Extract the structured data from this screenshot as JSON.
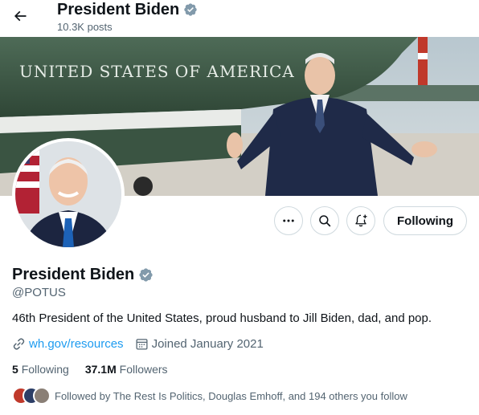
{
  "header": {
    "title": "President Biden",
    "posts": "10.3K posts"
  },
  "banner": {
    "plane_text": "UNITED STATES OF AMERICA"
  },
  "actions": {
    "more_icon": "more-icon",
    "search_icon": "search-icon",
    "notify_icon": "bell-plus-icon",
    "follow_label": "Following"
  },
  "profile": {
    "name": "President Biden",
    "handle": "@POTUS",
    "bio": "46th President of the United States, proud husband to Jill Biden, dad, and pop.",
    "website": "wh.gov/resources",
    "joined": "Joined January 2021",
    "following_count": "5",
    "following_label": "Following",
    "followers_count": "37.1M",
    "followers_label": "Followers",
    "followed_by": "Followed by The Rest Is Politics, Douglas Emhoff, and 194 others you follow"
  },
  "colors": {
    "accent": "#1d9bf0",
    "verified": "#829aab",
    "secondary_text": "#536471"
  }
}
